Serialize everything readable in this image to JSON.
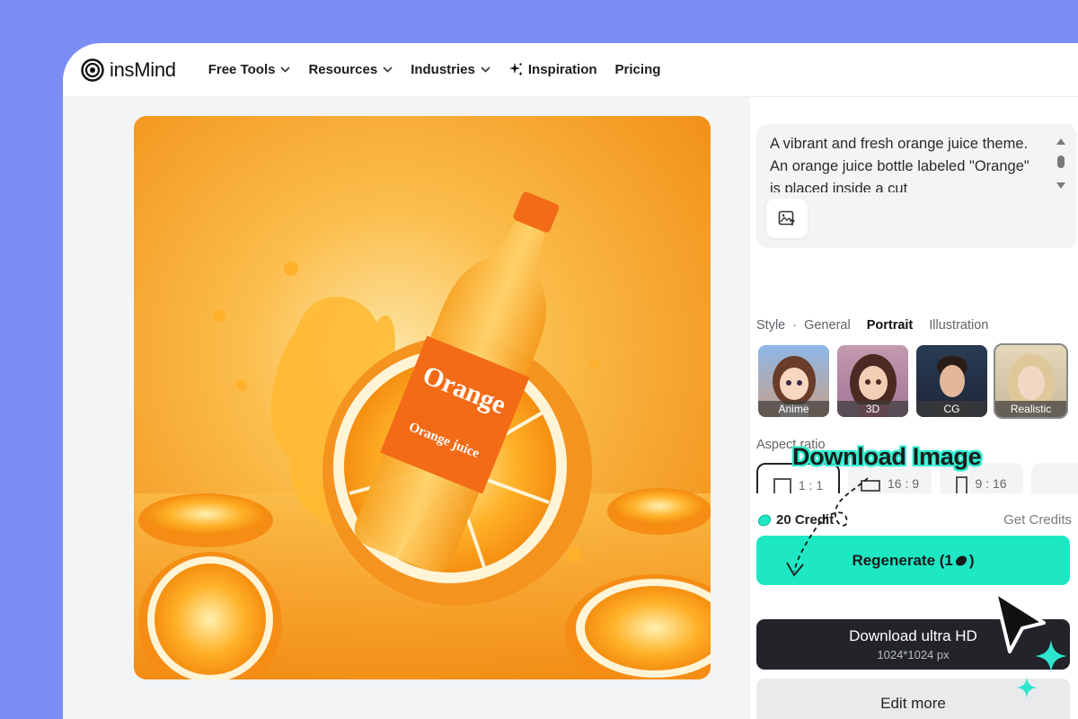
{
  "brand": {
    "name": "insMind"
  },
  "nav": [
    {
      "label": "Free Tools",
      "has_dropdown": true,
      "icon": ""
    },
    {
      "label": "Resources",
      "has_dropdown": true,
      "icon": ""
    },
    {
      "label": "Industries",
      "has_dropdown": true,
      "icon": ""
    },
    {
      "label": "Inspiration",
      "has_dropdown": false,
      "icon": "sparkle-icon"
    },
    {
      "label": "Pricing",
      "has_dropdown": false,
      "icon": ""
    }
  ],
  "image": {
    "bottle_label": "Orange",
    "bottle_sublabel": "Orange juice"
  },
  "prompt": {
    "text": "A vibrant and fresh orange juice theme. An orange juice bottle labeled \"Orange\" is placed inside a cut"
  },
  "style": {
    "label": "Style",
    "options": [
      "General",
      "Portrait",
      "Illustration"
    ],
    "active": "Portrait",
    "thumbnails": [
      {
        "label": "Anime",
        "selected": false
      },
      {
        "label": "3D",
        "selected": false
      },
      {
        "label": "CG",
        "selected": false
      },
      {
        "label": "Realistic",
        "selected": true
      }
    ]
  },
  "aspect": {
    "label": "Aspect ratio",
    "options": [
      {
        "label": "1 : 1",
        "selected": true
      },
      {
        "label": "16 : 9",
        "selected": false
      },
      {
        "label": "9 : 16",
        "selected": false
      }
    ]
  },
  "credits": {
    "amount": "20 Credit",
    "get_label": "Get Credits"
  },
  "buttons": {
    "regenerate": "Regenerate (1",
    "regenerate_close": ")",
    "download": "Download ultra HD",
    "download_size": "1024*1024 px",
    "edit": "Edit more"
  },
  "callout": {
    "text": "Download Image"
  },
  "colors": {
    "background": "#7b8cf5",
    "accent_teal": "#1de8c3",
    "download_dark": "#22242a",
    "orange": "#f5931f"
  }
}
